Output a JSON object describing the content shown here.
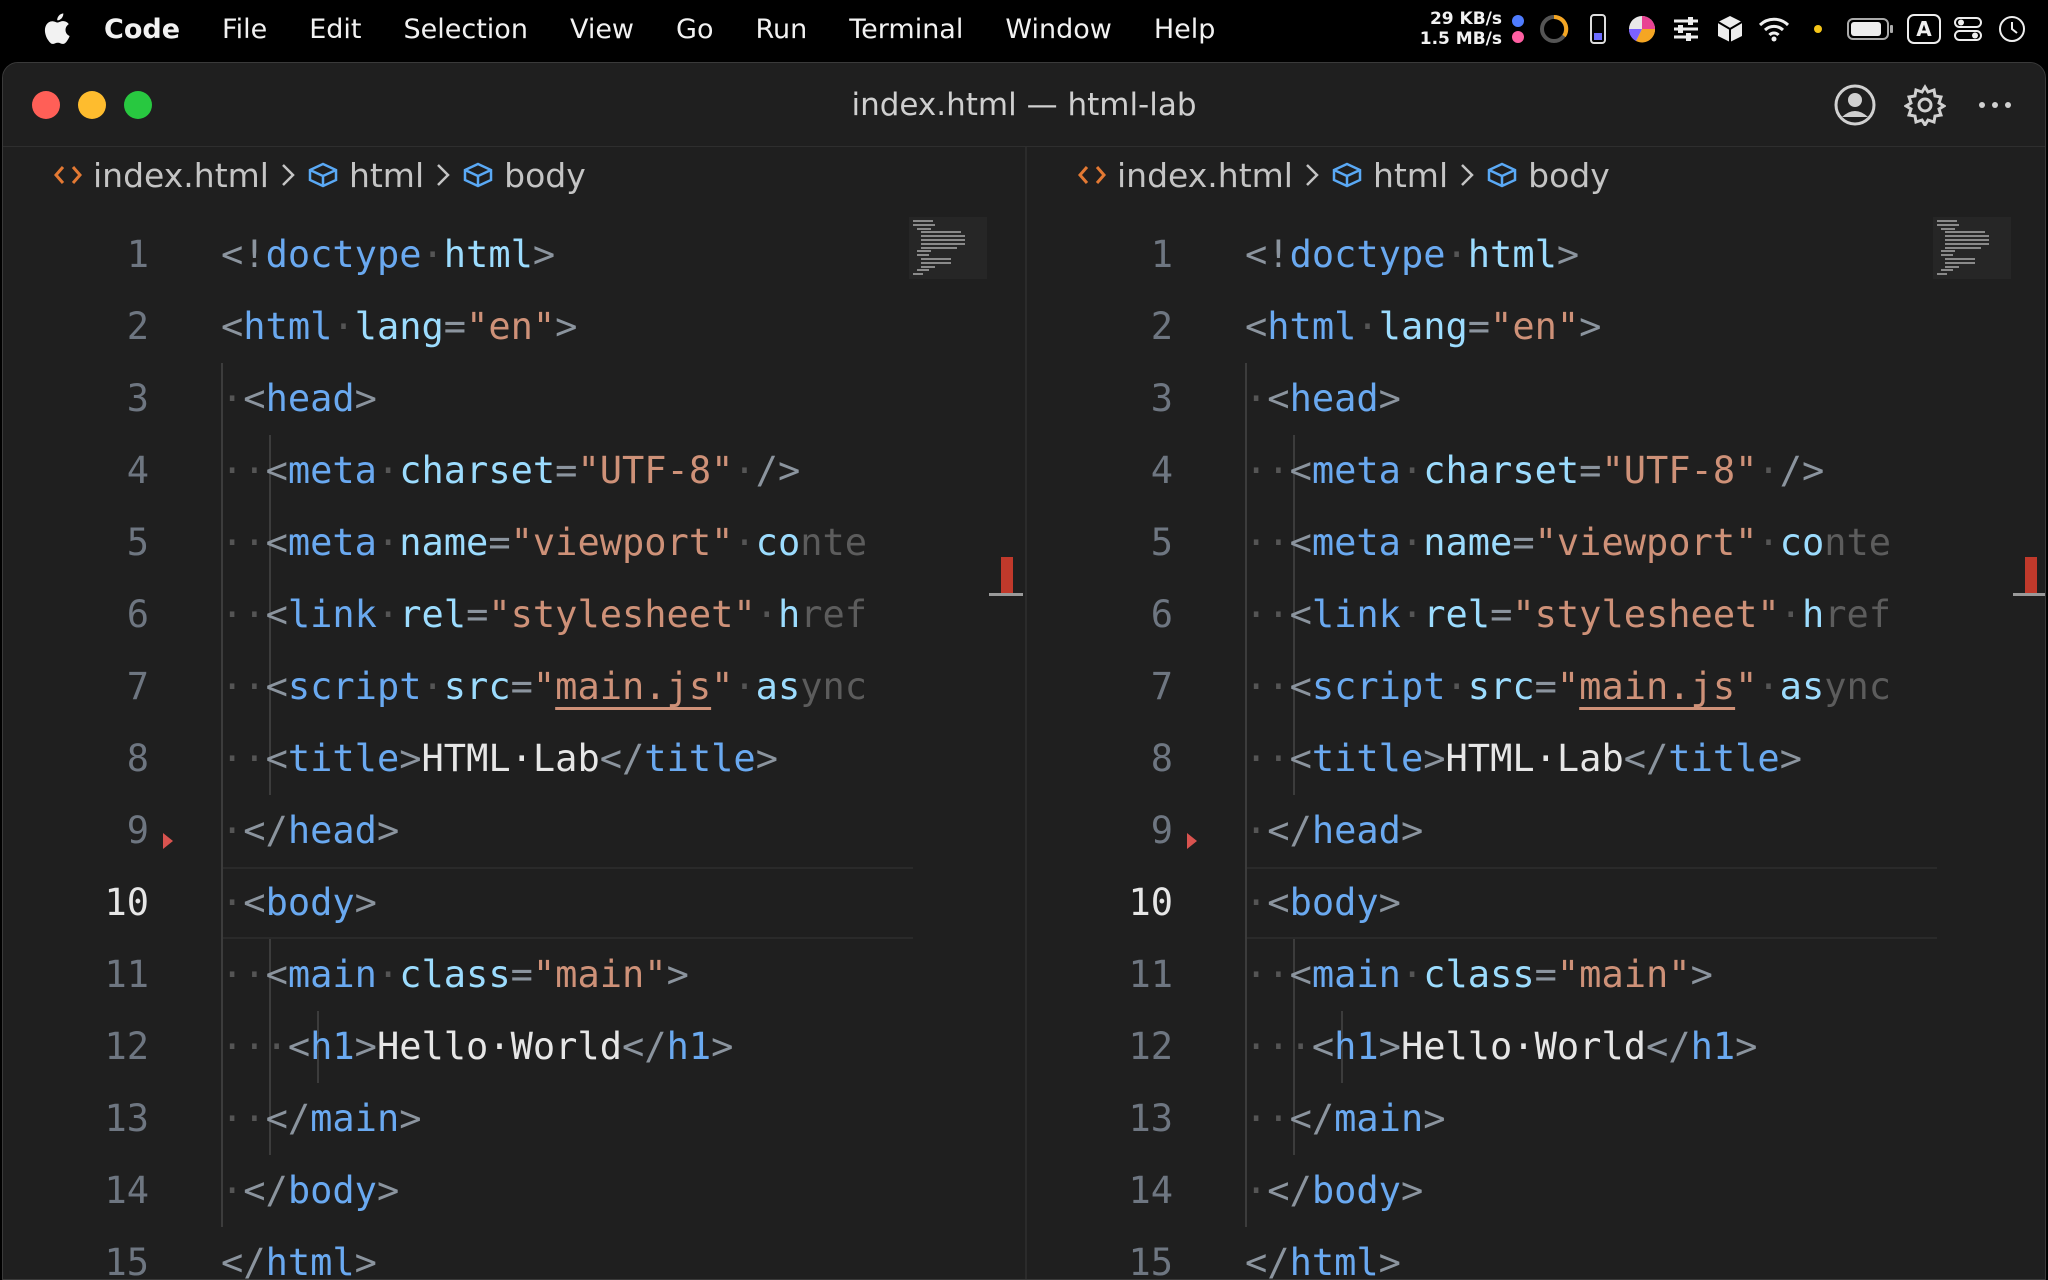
{
  "menubar": {
    "app": "Code",
    "items": [
      "File",
      "Edit",
      "Selection",
      "View",
      "Go",
      "Run",
      "Terminal",
      "Window",
      "Help"
    ],
    "net_up": "29 KB/s",
    "net_down": "1.5 MB/s",
    "input_source": "A"
  },
  "window": {
    "title": "index.html — html-lab",
    "colors": {
      "close": "#ff5f57",
      "minimize": "#febc2e",
      "zoom": "#28c840"
    }
  },
  "breadcrumb": {
    "file": "index.html",
    "items": [
      "html",
      "body"
    ]
  },
  "editor": {
    "active_line": 10,
    "lines": [
      {
        "n": "1",
        "tokens": [
          [
            "p",
            "<!"
          ],
          [
            "t",
            "doctype"
          ],
          [
            "ws",
            "·"
          ],
          [
            "a",
            "html"
          ],
          [
            "p",
            ">"
          ]
        ]
      },
      {
        "n": "2",
        "tokens": [
          [
            "p",
            "<"
          ],
          [
            "t",
            "html"
          ],
          [
            "ws",
            "·"
          ],
          [
            "a",
            "lang"
          ],
          [
            "p",
            "="
          ],
          [
            "s",
            "\"en\""
          ],
          [
            "p",
            ">"
          ]
        ]
      },
      {
        "n": "3",
        "tokens": [
          [
            "ws",
            "·"
          ],
          [
            "p",
            "<"
          ],
          [
            "t",
            "head"
          ],
          [
            "p",
            ">"
          ]
        ]
      },
      {
        "n": "4",
        "tokens": [
          [
            "ws",
            "··"
          ],
          [
            "p",
            "<"
          ],
          [
            "t",
            "meta"
          ],
          [
            "ws",
            "·"
          ],
          [
            "a",
            "charset"
          ],
          [
            "p",
            "="
          ],
          [
            "s",
            "\"UTF-8\""
          ],
          [
            "ws",
            "·"
          ],
          [
            "p",
            "/>"
          ]
        ]
      },
      {
        "n": "5",
        "tokens": [
          [
            "ws",
            "··"
          ],
          [
            "p",
            "<"
          ],
          [
            "t",
            "meta"
          ],
          [
            "ws",
            "·"
          ],
          [
            "a",
            "name"
          ],
          [
            "p",
            "="
          ],
          [
            "s",
            "\"viewport\""
          ],
          [
            "ws",
            "·"
          ],
          [
            "a",
            "co"
          ],
          [
            "f",
            "nte"
          ]
        ]
      },
      {
        "n": "6",
        "tokens": [
          [
            "ws",
            "··"
          ],
          [
            "p",
            "<"
          ],
          [
            "t",
            "link"
          ],
          [
            "ws",
            "·"
          ],
          [
            "a",
            "rel"
          ],
          [
            "p",
            "="
          ],
          [
            "s",
            "\"stylesheet\""
          ],
          [
            "ws",
            "·"
          ],
          [
            "a",
            "h"
          ],
          [
            "f",
            "ref"
          ]
        ]
      },
      {
        "n": "7",
        "tokens": [
          [
            "ws",
            "··"
          ],
          [
            "p",
            "<"
          ],
          [
            "t",
            "script"
          ],
          [
            "ws",
            "·"
          ],
          [
            "a",
            "src"
          ],
          [
            "p",
            "="
          ],
          [
            "s",
            "\""
          ],
          [
            "su",
            "main.js"
          ],
          [
            "s",
            "\""
          ],
          [
            "ws",
            "·"
          ],
          [
            "a",
            "as"
          ],
          [
            "f",
            "ync"
          ]
        ]
      },
      {
        "n": "8",
        "tokens": [
          [
            "ws",
            "··"
          ],
          [
            "p",
            "<"
          ],
          [
            "t",
            "title"
          ],
          [
            "p",
            ">"
          ],
          [
            "x",
            "HTML·Lab"
          ],
          [
            "p",
            "</"
          ],
          [
            "t",
            "title"
          ],
          [
            "p",
            ">"
          ]
        ]
      },
      {
        "n": "9",
        "tokens": [
          [
            "ws",
            "·"
          ],
          [
            "p",
            "</"
          ],
          [
            "t",
            "head"
          ],
          [
            "p",
            ">"
          ]
        ]
      },
      {
        "n": "10",
        "tokens": [
          [
            "ws",
            "·"
          ],
          [
            "p",
            "<"
          ],
          [
            "t",
            "body"
          ],
          [
            "p",
            ">"
          ]
        ]
      },
      {
        "n": "11",
        "tokens": [
          [
            "ws",
            "··"
          ],
          [
            "p",
            "<"
          ],
          [
            "t",
            "main"
          ],
          [
            "ws",
            "·"
          ],
          [
            "a",
            "class"
          ],
          [
            "p",
            "="
          ],
          [
            "s",
            "\"main\""
          ],
          [
            "p",
            ">"
          ]
        ]
      },
      {
        "n": "12",
        "tokens": [
          [
            "ws",
            "···"
          ],
          [
            "p",
            "<"
          ],
          [
            "t",
            "h1"
          ],
          [
            "p",
            ">"
          ],
          [
            "x",
            "Hello·World"
          ],
          [
            "p",
            "</"
          ],
          [
            "t",
            "h1"
          ],
          [
            "p",
            ">"
          ]
        ]
      },
      {
        "n": "13",
        "tokens": [
          [
            "ws",
            "··"
          ],
          [
            "p",
            "</"
          ],
          [
            "t",
            "main"
          ],
          [
            "p",
            ">"
          ]
        ]
      },
      {
        "n": "14",
        "tokens": [
          [
            "ws",
            "·"
          ],
          [
            "p",
            "</"
          ],
          [
            "t",
            "body"
          ],
          [
            "p",
            ">"
          ]
        ]
      },
      {
        "n": "15",
        "tokens": [
          [
            "p",
            "</"
          ],
          [
            "t",
            "html"
          ],
          [
            "p",
            ">"
          ]
        ]
      }
    ]
  }
}
